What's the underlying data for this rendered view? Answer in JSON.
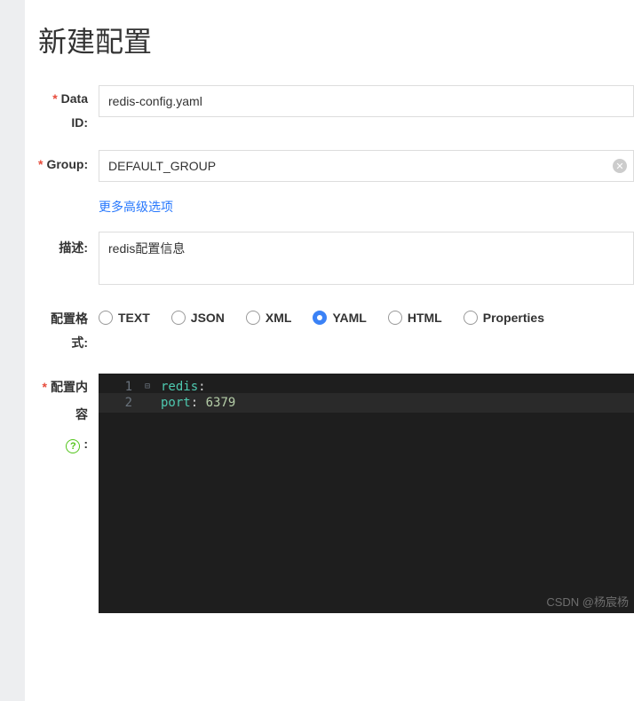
{
  "title": "新建配置",
  "fields": {
    "dataId": {
      "label": "Data ID:",
      "value": "redis-config.yaml",
      "required": true
    },
    "group": {
      "label": "Group:",
      "value": "DEFAULT_GROUP",
      "required": true
    },
    "advanced": {
      "label": "更多高级选项"
    },
    "description": {
      "label": "描述:",
      "value": "redis配置信息"
    },
    "format": {
      "label": "配置格式:",
      "options": [
        "TEXT",
        "JSON",
        "XML",
        "YAML",
        "HTML",
        "Properties"
      ],
      "selected": "YAML"
    },
    "content": {
      "label": "配置内容",
      "required": true,
      "help": "?",
      "colon": ":",
      "code": {
        "line1_key": "redis",
        "line2_indent": "  ",
        "line2_key": "port",
        "line2_val": "6379",
        "punct": ":"
      }
    }
  },
  "watermark": "CSDN @杨宸杨"
}
